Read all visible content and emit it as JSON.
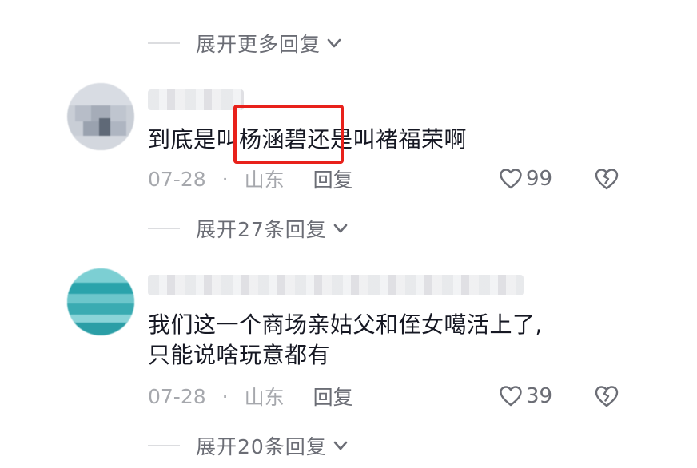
{
  "top_expand": {
    "label": "展开更多回复"
  },
  "comments": [
    {
      "text": "到底是叫杨涵碧还是叫褚福荣啊",
      "date": "07-28",
      "separator": "·",
      "location": "山东",
      "reply_label": "回复",
      "likes": "99",
      "expand_label": "展开27条回复"
    },
    {
      "text_line1": "我们这一个商场亲姑父和侄女噶活上了,",
      "text_line2": "只能说啥玩意都有",
      "date": "07-28",
      "separator": "·",
      "location": "山东",
      "reply_label": "回复",
      "likes": "39",
      "expand_label": "展开20条回复"
    }
  ],
  "colors": {
    "highlight_box": "#e8211b",
    "meta_gray": "#a6a8ad",
    "text": "#161823"
  },
  "icons": [
    "chevron-down-icon",
    "heart-outline-icon",
    "broken-heart-icon"
  ]
}
